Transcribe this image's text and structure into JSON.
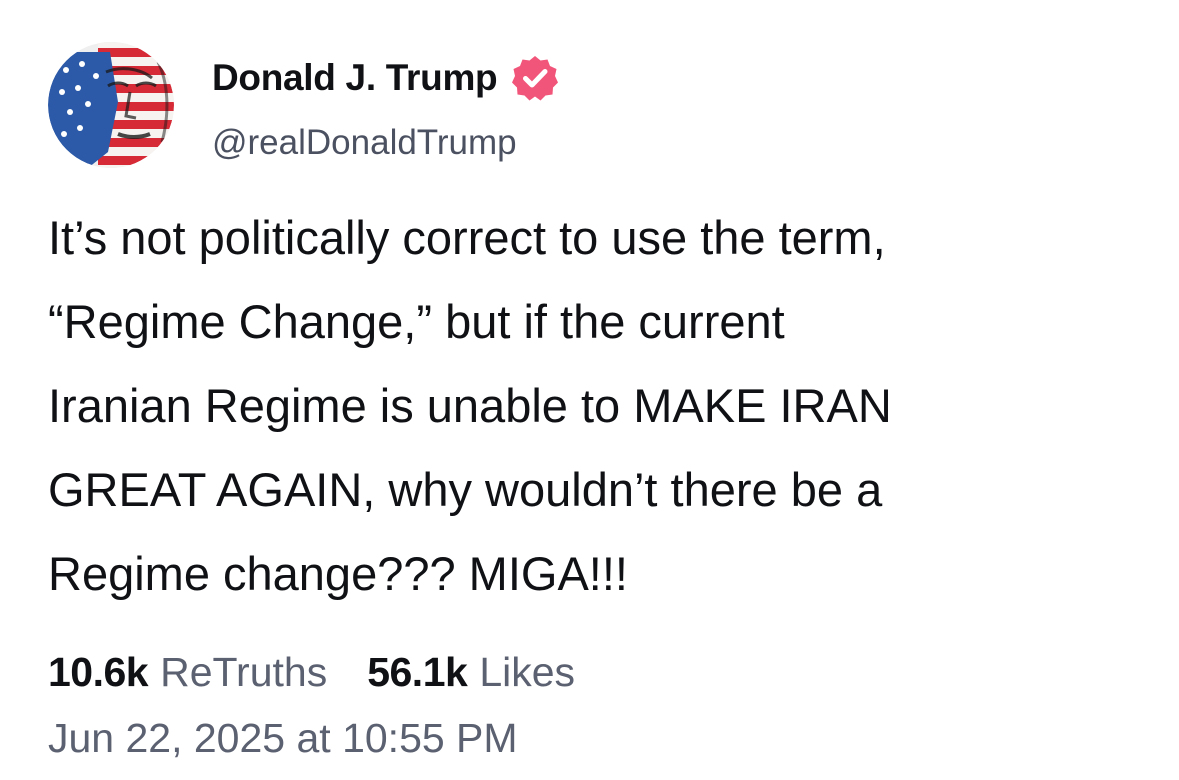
{
  "author": {
    "display_name": "Donald J. Trump",
    "handle": "@realDonaldTrump",
    "avatar_icon": "portrait-flag-avatar",
    "verified_icon": "verified-badge-icon",
    "verified_color": "#f2557a"
  },
  "post": {
    "lines": [
      "It’s not politically correct to use the term,",
      "“Regime Change,” but if the current",
      "Iranian Regime is unable to MAKE IRAN",
      "GREAT AGAIN, why wouldn’t there be a",
      "Regime change??? MIGA!!!"
    ]
  },
  "stats": {
    "retruths_count": "10.6k",
    "retruths_label": "ReTruths",
    "likes_count": "56.1k",
    "likes_label": "Likes"
  },
  "timestamp": "Jun 22, 2025 at 10:55 PM",
  "colors": {
    "text_primary": "#0f1115",
    "text_secondary": "#5b6170",
    "background": "#ffffff"
  }
}
